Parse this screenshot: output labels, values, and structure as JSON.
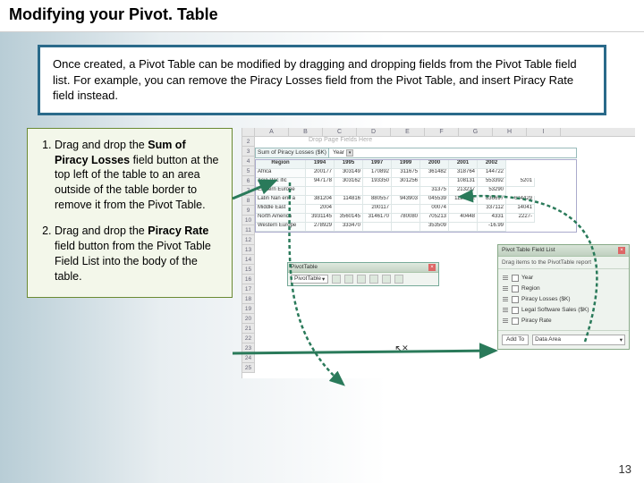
{
  "title": "Modifying your Pivot. Table",
  "intro": "Once created, a Pivot Table can be modified by dragging and dropping fields from the Pivot Table field list.  For example, you can remove the Piracy Losses field from the Pivot Table, and insert Piracy Rate field instead.",
  "steps": [
    {
      "prefix": "Drag and drop the ",
      "bold": "Sum of Piracy Losses",
      "suffix": " field button at the top left of the table to an area outside of the table border to remove it from the Pivot Table."
    },
    {
      "prefix": "Drag and drop the ",
      "bold": "Piracy Rate",
      "suffix": " field button from the Pivot Table Field List into the body of the table."
    }
  ],
  "excel": {
    "cols": [
      "A",
      "B",
      "C",
      "D",
      "E",
      "F",
      "G",
      "H",
      "I"
    ],
    "rows": [
      "2",
      "3",
      "4",
      "5",
      "6",
      "7",
      "8",
      "9",
      "10",
      "11",
      "12",
      "13",
      "14",
      "15",
      "16",
      "17",
      "18",
      "19",
      "20",
      "21",
      "22",
      "23",
      "24",
      "25"
    ],
    "page_drop_hint": "Drop Page Fields Here",
    "pivot_label": "Sum of Piracy Losses ($K)",
    "pivot_sel": "Year",
    "pivot_header": {
      "region": "Region",
      "years": [
        "1994",
        "1995",
        "1997",
        "1999",
        "2000",
        "2001",
        "2002"
      ]
    },
    "pivot_rows": [
      {
        "region": "Africa",
        "vals": [
          "200177",
          "303149",
          "170892",
          "311675",
          "361482",
          "318764",
          "144722"
        ]
      },
      {
        "region": "Asia Pac ific",
        "vals": [
          "947178",
          "303162",
          "193350",
          "301256",
          "",
          "108131",
          "553392",
          "5201"
        ]
      },
      {
        "region": "Eastern Europe",
        "vals": [
          "",
          "",
          "",
          "",
          "31375",
          "213237",
          "53290"
        ]
      },
      {
        "region": "Latin Nan eric a",
        "vals": [
          "381204",
          "114816",
          "880557",
          "943903",
          "045539",
          "1127632",
          "836697",
          "624429"
        ]
      },
      {
        "region": "Middle East",
        "vals": [
          "2004",
          "",
          "200117",
          "",
          "00074",
          "",
          "337112",
          "14041"
        ]
      },
      {
        "region": "North America",
        "vals": [
          "3931145",
          "3560145",
          "3146170",
          "780080",
          "705213",
          "40448",
          "4331",
          "2227-"
        ]
      },
      {
        "region": "Western Europe",
        "vals": [
          "278929",
          "333470",
          "",
          "",
          "353509",
          "",
          "-16.99"
        ]
      }
    ]
  },
  "pt_toolbar": {
    "title": "PivotTable",
    "menu": "PivotTable"
  },
  "fieldlist": {
    "title": "Pivot Table Field List",
    "hint": "Drag items to the PivotTable report",
    "items": [
      "Year",
      "Region",
      "Piracy Losses ($K)",
      "Legal Software Sales ($K)",
      "Piracy Rate"
    ],
    "add_to": "Add To",
    "area": "Data Area"
  },
  "page_number": "13"
}
